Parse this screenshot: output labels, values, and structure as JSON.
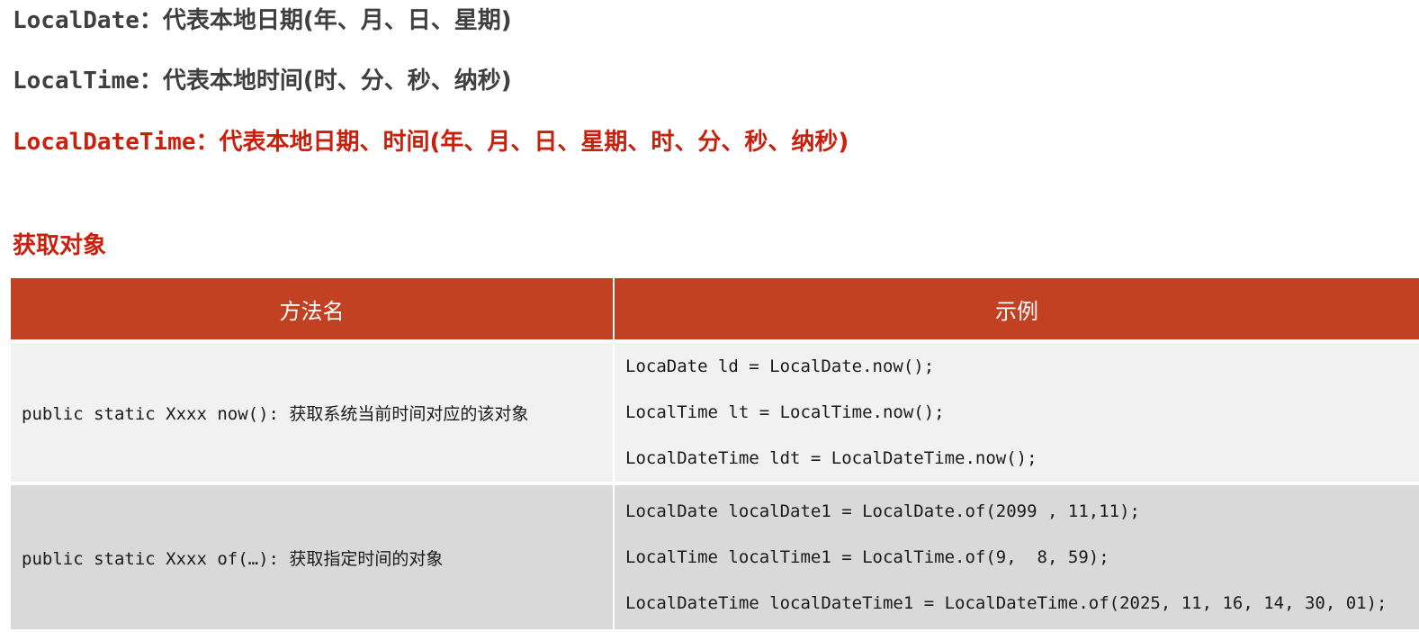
{
  "lines": [
    {
      "class": "LocalDate",
      "desc": "：代表本地日期(年、月、日、星期)"
    },
    {
      "class": "LocalTime",
      "desc": "：代表本地时间(时、分、秒、纳秒)"
    },
    {
      "class": "LocalDateTime",
      "desc": "：代表本地日期、时间(年、月、日、星期、时、分、秒、纳秒)"
    }
  ],
  "section_title": "获取对象",
  "table": {
    "headers": [
      "方法名",
      "示例"
    ],
    "rows": [
      {
        "method": "public static Xxxx now(): 获取系统当前时间对应的该对象",
        "examples": [
          "LocaDate ld = LocalDate.now();",
          "LocalTime lt = LocalTime.now();",
          "LocalDateTime ldt = LocalDateTime.now();"
        ]
      },
      {
        "method": "public static Xxxx of(…): 获取指定时间的对象",
        "examples": [
          "LocalDate localDate1 = LocalDate.of(2099 , 11,11);",
          "LocalTime localTime1 = LocalTime.of(9,  8, 59);",
          "LocalDateTime localDateTime1 = LocalDateTime.of(2025, 11, 16, 14, 30, 01);"
        ]
      }
    ]
  },
  "colors": {
    "gray_text": "#3f3f3f",
    "red_text": "#c9200e",
    "header_bg": "#c24122",
    "row1_bg": "#f1f1f1",
    "row2_bg": "#d9d9d9"
  }
}
